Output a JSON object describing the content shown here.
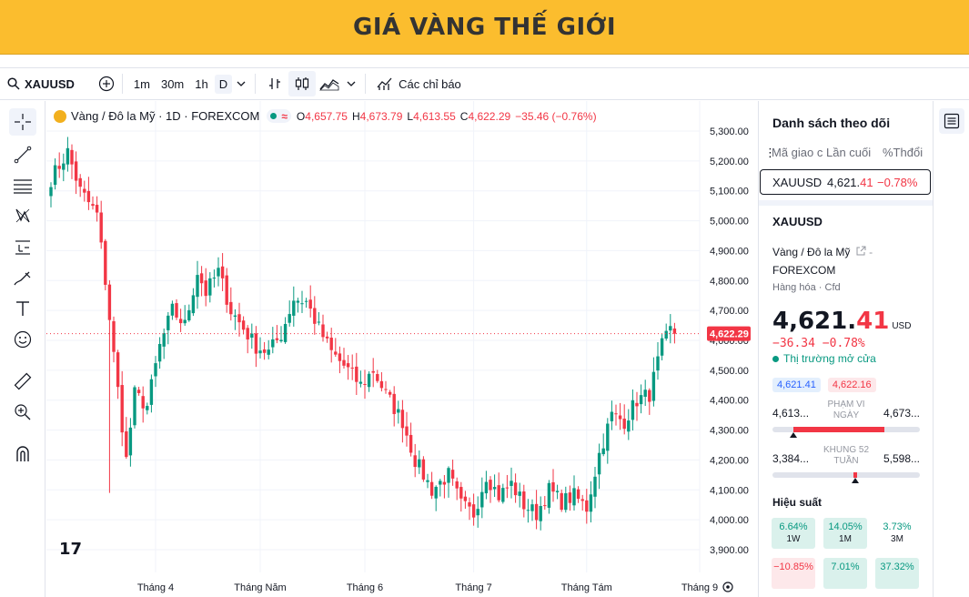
{
  "banner": {
    "title": "GIÁ VÀNG THẾ GIỚI"
  },
  "toolbar": {
    "symbol": "XAUUSD",
    "intervals": [
      "1m",
      "30m",
      "1h",
      "D"
    ],
    "active_interval": "D",
    "indicators_label": "Các chỉ báo"
  },
  "legend": {
    "title": "Vàng / Đô la Mỹ · 1D · FOREXCOM",
    "wave": "≈",
    "o_label": "O",
    "o": "4,657.75",
    "h_label": "H",
    "h": "4,673.79",
    "l_label": "L",
    "l": "4,613.55",
    "c_label": "C",
    "c": "4,622.29",
    "change": "−35.46 (−0.76%)"
  },
  "logo": "17",
  "chart_data": {
    "type": "candlestick",
    "series_symbol": "XAUUSD",
    "current_price_label": "4,622.29",
    "current_price": 4622.29,
    "y_ticks": [
      "5,300.00",
      "5,200.00",
      "5,100.00",
      "5,000.00",
      "4,900.00",
      "4,800.00",
      "4,700.00",
      "4,600.00",
      "4,500.00",
      "4,400.00",
      "4,300.00",
      "4,200.00",
      "4,100.00",
      "4,000.00",
      "3,900.00"
    ],
    "y_values": [
      5300,
      5200,
      5100,
      5000,
      4900,
      4800,
      4700,
      4600,
      4500,
      4400,
      4300,
      4200,
      4100,
      4000,
      3900
    ],
    "ylim": [
      3870,
      5330
    ],
    "x_ticks": [
      "Tháng 4",
      "Tháng Năm",
      "Tháng 6",
      "Tháng 7",
      "Tháng Tám",
      "Tháng 9"
    ],
    "x_tick_index": [
      25,
      50,
      75,
      101,
      128,
      155
    ],
    "n": 150,
    "anchors": [
      [
        0,
        5140
      ],
      [
        4,
        5230
      ],
      [
        7,
        5100
      ],
      [
        11,
        5020
      ],
      [
        13,
        4800
      ],
      [
        15,
        4550
      ],
      [
        18,
        4200
      ],
      [
        20,
        4420
      ],
      [
        23,
        4380
      ],
      [
        26,
        4580
      ],
      [
        29,
        4700
      ],
      [
        32,
        4650
      ],
      [
        35,
        4830
      ],
      [
        37,
        4760
      ],
      [
        40,
        4830
      ],
      [
        43,
        4700
      ],
      [
        46,
        4640
      ],
      [
        49,
        4580
      ],
      [
        52,
        4560
      ],
      [
        55,
        4620
      ],
      [
        58,
        4740
      ],
      [
        61,
        4730
      ],
      [
        64,
        4640
      ],
      [
        67,
        4560
      ],
      [
        71,
        4500
      ],
      [
        74,
        4450
      ],
      [
        77,
        4500
      ],
      [
        80,
        4420
      ],
      [
        84,
        4330
      ],
      [
        87,
        4200
      ],
      [
        91,
        4100
      ],
      [
        95,
        4150
      ],
      [
        98,
        4050
      ],
      [
        101,
        4020
      ],
      [
        104,
        4150
      ],
      [
        107,
        4080
      ],
      [
        110,
        4120
      ],
      [
        113,
        4050
      ],
      [
        116,
        4020
      ],
      [
        119,
        4100
      ],
      [
        122,
        4060
      ],
      [
        125,
        4080
      ],
      [
        128,
        4040
      ],
      [
        131,
        4220
      ],
      [
        134,
        4350
      ],
      [
        137,
        4330
      ],
      [
        140,
        4400
      ],
      [
        143,
        4420
      ],
      [
        146,
        4580
      ],
      [
        149,
        4660
      ],
      [
        150,
        4622
      ]
    ]
  },
  "watchlist": {
    "title": "Danh sách theo dõi",
    "col_symbol": "Mã giao c",
    "col_last": "Lần cuối",
    "col_change": "%Thđổi",
    "row": {
      "symbol": "XAUUSD",
      "last_main": "4,621.",
      "last_dec": "41",
      "pct": "−0.78%"
    }
  },
  "details": {
    "symbol": "XAUUSD",
    "desc1": "Vàng / Đô la Mỹ",
    "desc2": "FOREXCOM",
    "category": "Hàng hóa",
    "subcategory": "Cfd",
    "price_main": "4,621.",
    "price_dec": "41",
    "currency": "USD",
    "change": "−36.34",
    "change_pct": "−0.78%",
    "market_status": "Thị trường mở cửa",
    "bid": "4,621.41",
    "ask": "4,622.16",
    "day_range": {
      "low": "4,613...",
      "high": "4,673...",
      "label1": "PHẠM VI",
      "label2": "NGÀY",
      "position": 0.14
    },
    "week52": {
      "low": "3,384...",
      "high": "5,598...",
      "label1": "KHUNG 52",
      "label2": "TUẦN",
      "position": 0.56
    },
    "performance_title": "Hiệu suất",
    "performance": [
      {
        "value": "6.64%",
        "period": "1W",
        "tone": "g"
      },
      {
        "value": "14.05%",
        "period": "1M",
        "tone": "g"
      },
      {
        "value": "3.73%",
        "period": "3M",
        "tone": "n"
      },
      {
        "value": "−10.85%",
        "period": "",
        "tone": "r"
      },
      {
        "value": "7.01%",
        "period": "",
        "tone": "g"
      },
      {
        "value": "37.32%",
        "period": "",
        "tone": "g"
      }
    ]
  },
  "colors": {
    "up": "#089981",
    "down": "#f23645",
    "banner": "#fbbd2e"
  }
}
